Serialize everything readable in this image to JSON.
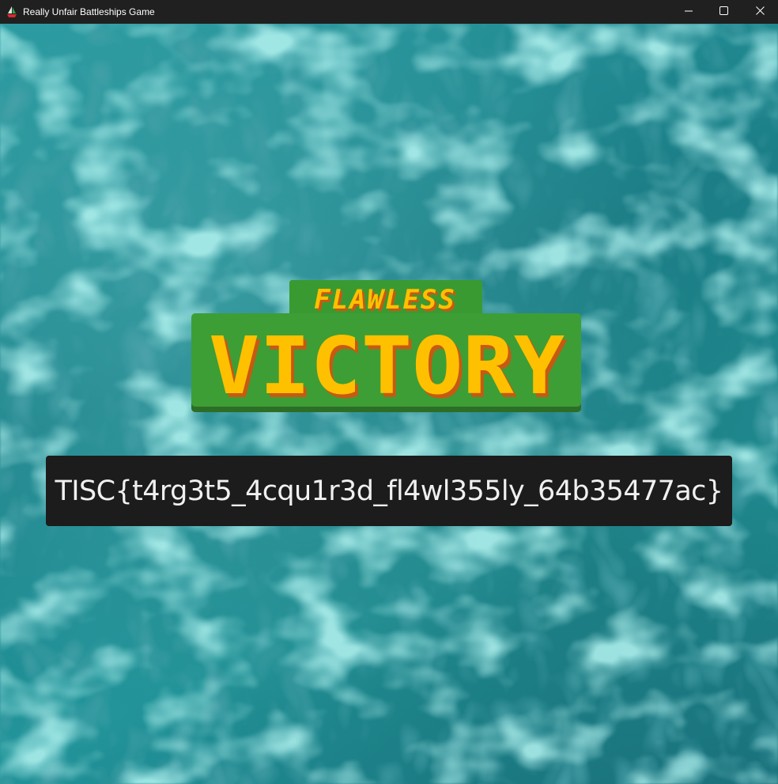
{
  "window": {
    "title": "Really Unfair Battleships Game"
  },
  "victory": {
    "top_text": "FLAWLESS",
    "main_text": "VICTORY"
  },
  "flag": {
    "text": "TISC{t4rg3t5_4cqu1r3d_fl4wl355ly_64b35477ac}"
  },
  "colors": {
    "titlebar": "#202020",
    "water": "#1f8a92",
    "banner_green": "#3a9a32",
    "banner_yellow": "#ffc000",
    "banner_shadow": "#c65a12",
    "flag_bg": "#1c1c1c"
  },
  "icons": {
    "app": "sailboat-icon",
    "minimize": "minimize-icon",
    "maximize": "maximize-icon",
    "close": "close-icon"
  }
}
